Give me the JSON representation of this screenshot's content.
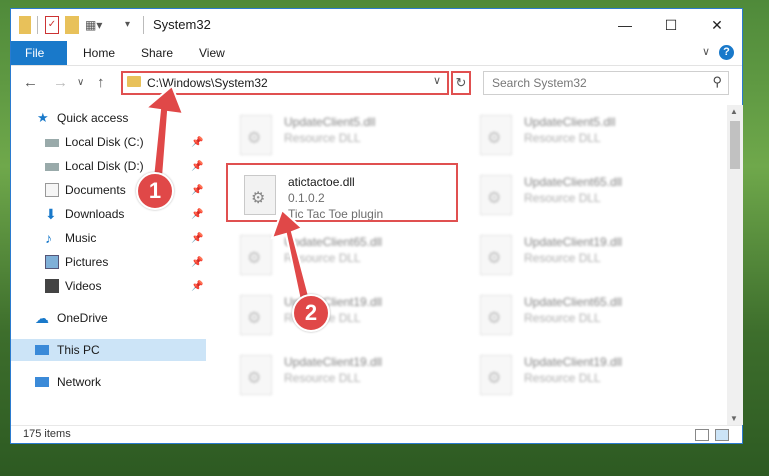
{
  "window": {
    "title": "System32",
    "controls": {
      "minimize": "—",
      "maximize": "☐",
      "close": "✕"
    }
  },
  "ribbon": {
    "tabs": [
      "File",
      "Home",
      "Share",
      "View"
    ],
    "help": "?"
  },
  "address_bar": {
    "path": "C:\\Windows\\System32",
    "search_placeholder": "Search System32"
  },
  "sidebar": {
    "items": [
      {
        "label": "Quick access",
        "icon": "star-icon",
        "pinned": false
      },
      {
        "label": "Local Disk (C:)",
        "icon": "drive-icon",
        "pinned": true
      },
      {
        "label": "Local Disk (D:)",
        "icon": "drive-icon",
        "pinned": true
      },
      {
        "label": "Documents",
        "icon": "documents-icon",
        "pinned": true
      },
      {
        "label": "Downloads",
        "icon": "download-icon",
        "pinned": true
      },
      {
        "label": "Music",
        "icon": "music-icon",
        "pinned": true
      },
      {
        "label": "Pictures",
        "icon": "pictures-icon",
        "pinned": true
      },
      {
        "label": "Videos",
        "icon": "videos-icon",
        "pinned": true
      },
      {
        "label": "OneDrive",
        "icon": "cloud-icon",
        "pinned": false
      },
      {
        "label": "This PC",
        "icon": "computer-icon",
        "pinned": false,
        "selected": true
      },
      {
        "label": "Network",
        "icon": "network-icon",
        "pinned": false
      }
    ]
  },
  "files": {
    "left_column": [
      {
        "name": "UpdateClient5.dll",
        "type": "Resource DLL"
      },
      {
        "name": "UpdateClient65.dll",
        "type": "Resource DLL"
      },
      {
        "name": "UpdateClient19.dll",
        "type": "Resource DLL"
      },
      {
        "name": "UpdateClient19.dll",
        "type": "Resource DLL"
      }
    ],
    "right_column": [
      {
        "name": "UpdateClient5.dll",
        "type": "Resource DLL"
      },
      {
        "name": "UpdateClient65.dll",
        "type": "Resource DLL"
      },
      {
        "name": "UpdateClient19.dll",
        "type": "Resource DLL"
      },
      {
        "name": "UpdateClient65.dll",
        "type": "Resource DLL"
      },
      {
        "name": "UpdateClient19.dll",
        "type": "Resource DLL"
      }
    ],
    "featured": {
      "name": "atictactoe.dll",
      "version": "0.1.0.2",
      "description": "Tic Tac Toe plugin"
    }
  },
  "status_bar": {
    "item_count": "175 items"
  },
  "annotations": {
    "step1": "1",
    "step2": "2"
  },
  "colors": {
    "accent": "#1979ca",
    "highlight": "#e05050"
  }
}
